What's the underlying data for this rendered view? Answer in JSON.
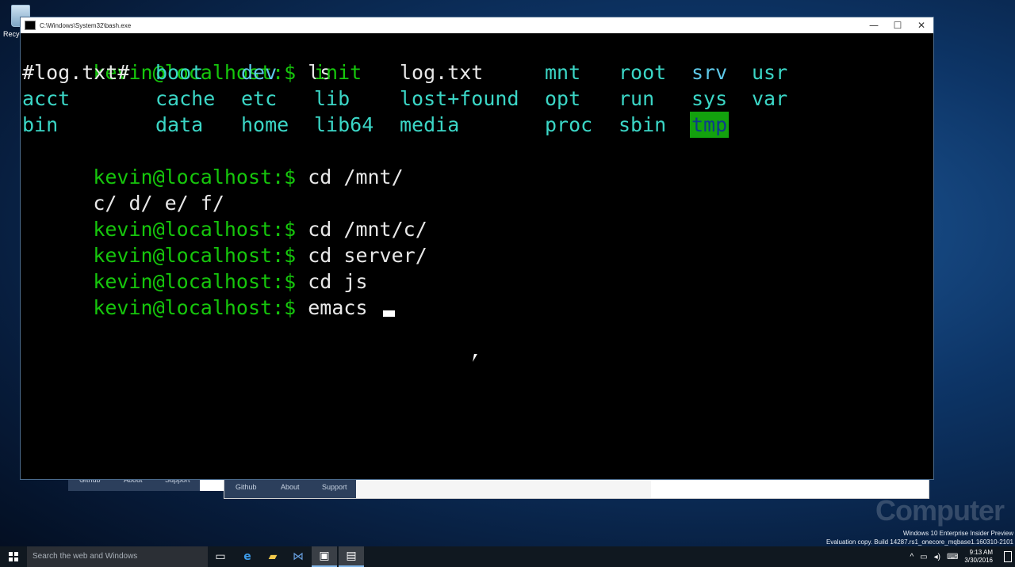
{
  "desktop": {
    "recycle_bin_label": "Recyc"
  },
  "background_windows": {
    "nav1": [
      "Github",
      "About",
      "Support"
    ],
    "nav2": [
      "Github",
      "About",
      "Support"
    ]
  },
  "window": {
    "title": "C:\\Windows\\System32\\bash.exe",
    "minimize": "—",
    "maximize": "☐",
    "close": "✕"
  },
  "terminal": {
    "prompt": "kevin@localhost:$",
    "ls_command": "ls",
    "listing": [
      [
        "#log.txt#",
        "boot",
        "dev",
        "init",
        "log.txt",
        "mnt",
        "root",
        "srv",
        "usr"
      ],
      [
        "acct",
        "cache",
        "etc",
        "lib",
        "lost+found",
        "opt",
        "run",
        "sys",
        "var"
      ],
      [
        "bin",
        "data",
        "home",
        "lib64",
        "media",
        "",
        "proc",
        "sbin",
        "tmp"
      ]
    ],
    "cmd_cd_mnt": "cd /mnt/",
    "mnt_output": "c/ d/ e/ f/",
    "cmd_cd_mnt_c": "cd /mnt/c/",
    "cmd_cd_server": "cd server/",
    "cmd_cd_js": "cd js",
    "cmd_emacs": "emacs "
  },
  "watermark": {
    "brand": "Computer",
    "line1": "Windows 10 Enterprise Insider Preview",
    "line2": "Evaluation copy. Build 14287.rs1_onecore_mqbase1.160310-2101"
  },
  "taskbar": {
    "search_placeholder": "Search the web and Windows",
    "time": "9:13 AM",
    "date": "3/30/2016"
  },
  "colors": {
    "prompt_green": "#16c60c",
    "dir_cyan": "#3bd6c6",
    "dir_blue": "#5ec8e8",
    "tmp_highlight": "#13a10e"
  }
}
